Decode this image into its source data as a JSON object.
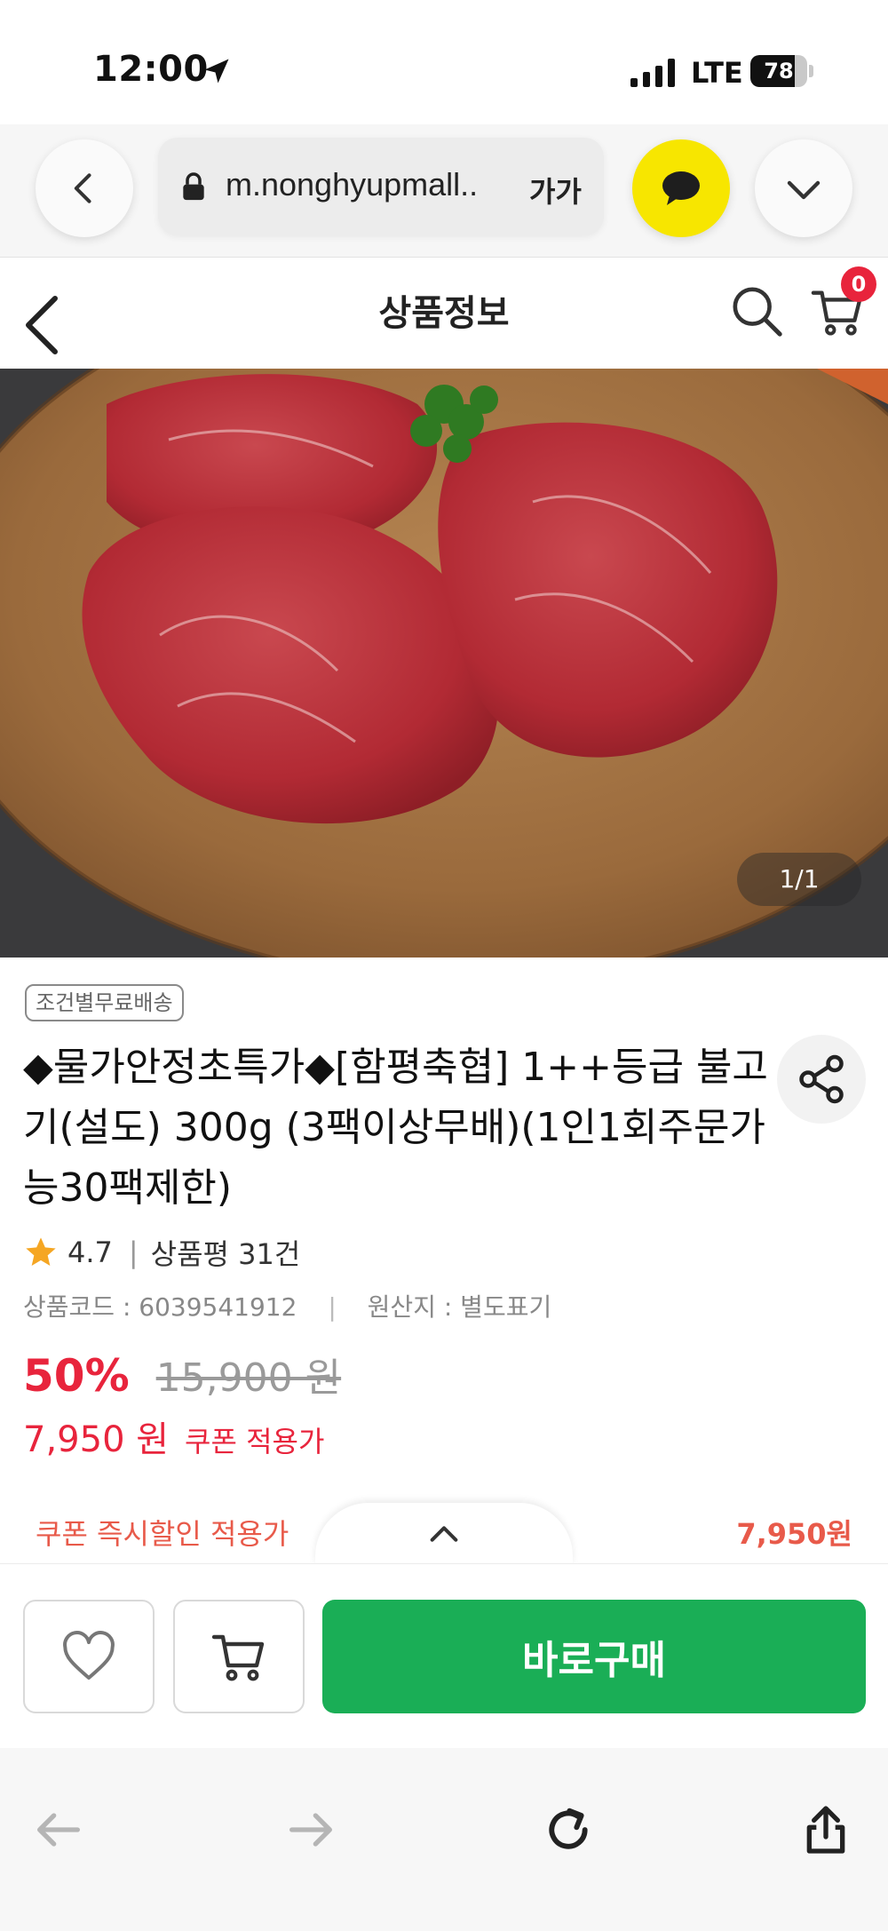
{
  "status_bar": {
    "time": "12:00",
    "network": "LTE",
    "battery_level": "78",
    "battery_fraction": 0.78
  },
  "browser": {
    "url": "m.nonghyupmall..",
    "font_size_label": "가가"
  },
  "header": {
    "title": "상품정보",
    "cart_count": "0"
  },
  "product": {
    "image_counter": "1/1",
    "shipping_badge": "조건별무료배송",
    "title": "◆물가안정초특가◆[함평축협] 1++등급 불고기(설도) 300g (3팩이상무배)(1인1회주문가능30팩제한)",
    "rating": "4.7",
    "rating_separator": "|",
    "review_count": "상품평 31건",
    "product_code": "상품코드 : 6039541912",
    "meta_separator": "|",
    "origin": "원산지 : 별도표기",
    "discount": "50%",
    "original_price": "15,900 원",
    "sale_price": "7,950 원",
    "coupon_label": "쿠폰 적용가"
  },
  "coupon_strip": {
    "label": "쿠폰 즉시할인 적용가",
    "price": "7,950원"
  },
  "actions": {
    "buy_label": "바로구매"
  },
  "colors": {
    "accent_red": "#e8243c",
    "buy_green": "#1aae56",
    "kakao_yellow": "#f7e600"
  }
}
